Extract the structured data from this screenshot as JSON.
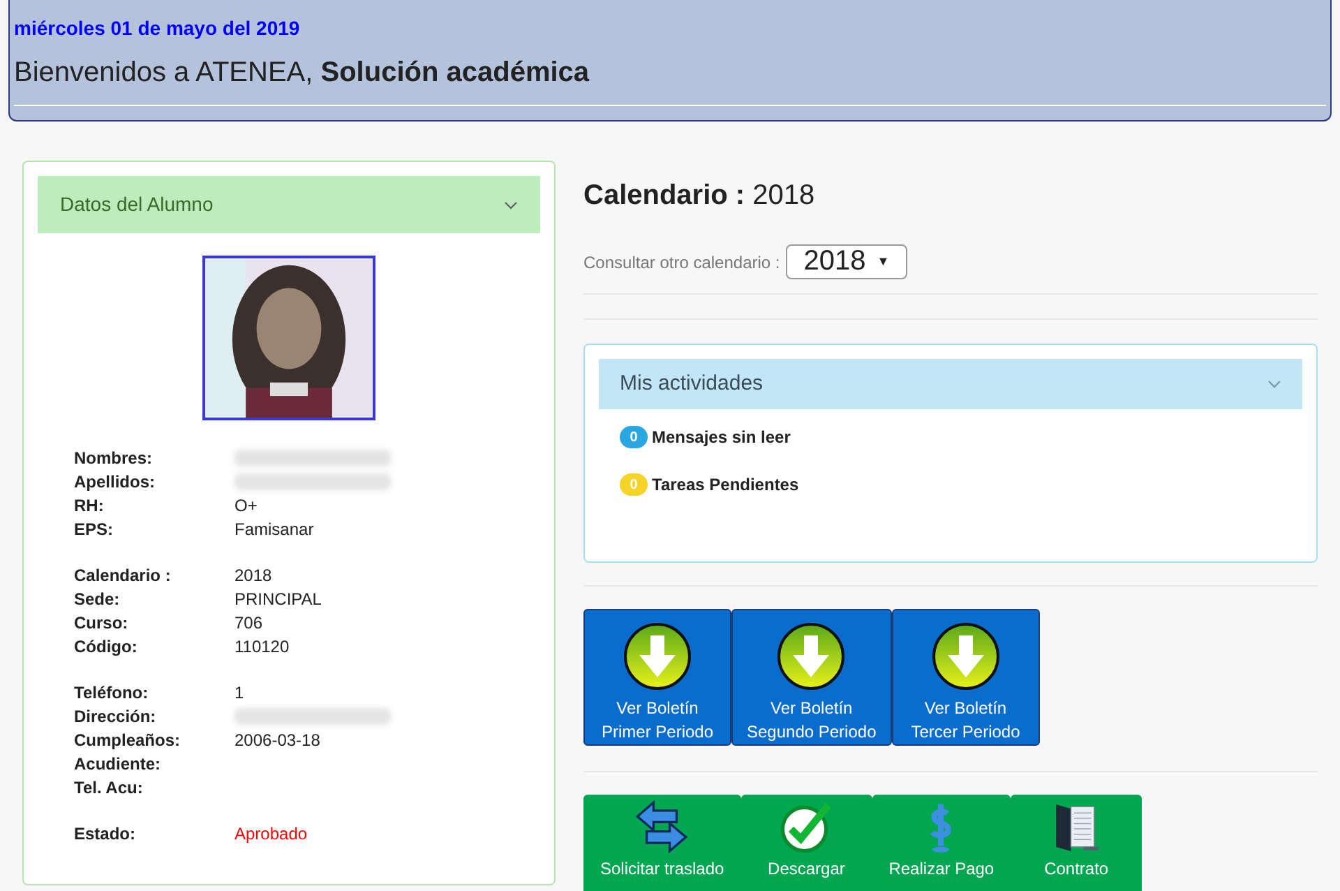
{
  "header": {
    "date": "miércoles 01 de mayo del 2019",
    "welcome": "Bienvenidos a ATENEA, **Solución académica**"
  },
  "student_panel": {
    "title": "Datos del Alumno",
    "expanded": true,
    "photo": {
      "kind": "picture"
    },
    "groups": [
      [
        {
          "label": "Nombres:",
          "blurred": true
        },
        {
          "label": "Apellidos:",
          "blurred": true
        },
        {
          "label": "RH:",
          "value": "O+"
        },
        {
          "label": "EPS:",
          "value": "Famisanar"
        }
      ],
      [
        {
          "label": "Calendario :",
          "value": "2018"
        },
        {
          "label": "Sede:",
          "value": "PRINCIPAL"
        },
        {
          "label": "Curso:",
          "value": "706"
        },
        {
          "label": "Código:",
          "value": "110120"
        }
      ],
      [
        {
          "label": "Teléfono:",
          "value": "1"
        },
        {
          "label": "Dirección:",
          "blurred": true
        },
        {
          "label": "Cumpleaños:",
          "value": "2006-03-18"
        },
        {
          "label": "Acudiente:"
        },
        {
          "label": "Tel. Acu:"
        }
      ],
      [
        {
          "label": "Estado:",
          "value": "Aprobado",
          "color": "#ff0000"
        }
      ]
    ]
  },
  "calendar": {
    "title": "Calendario :",
    "year": "2018",
    "select_label": "Consultar otro calendario :",
    "select_value": "2018",
    "select_caret": "▼"
  },
  "activities": {
    "title": "Mis actividades",
    "expanded": true,
    "items": [
      {
        "count": "0",
        "label": "Mensajes sin leer",
        "color": "#2aa7e0"
      },
      {
        "count": "0",
        "label": "Tareas Pendientes",
        "color": "#f5d327"
      }
    ]
  },
  "report_buttons": [
    {
      "line1": "Ver Boletín",
      "line2": "Primer Periodo"
    },
    {
      "line1": "Ver Boletín",
      "line2": "Segundo Periodo"
    },
    {
      "line1": "Ver Boletín",
      "line2": "Tercer Periodo"
    }
  ],
  "action_buttons": [
    {
      "kind": "transfer",
      "label": "Solicitar traslado"
    },
    {
      "kind": "check",
      "label": "Descargar"
    },
    {
      "kind": "dollar",
      "label": "Realizar Pago"
    },
    {
      "kind": "document",
      "label": "Contrato"
    }
  ]
}
